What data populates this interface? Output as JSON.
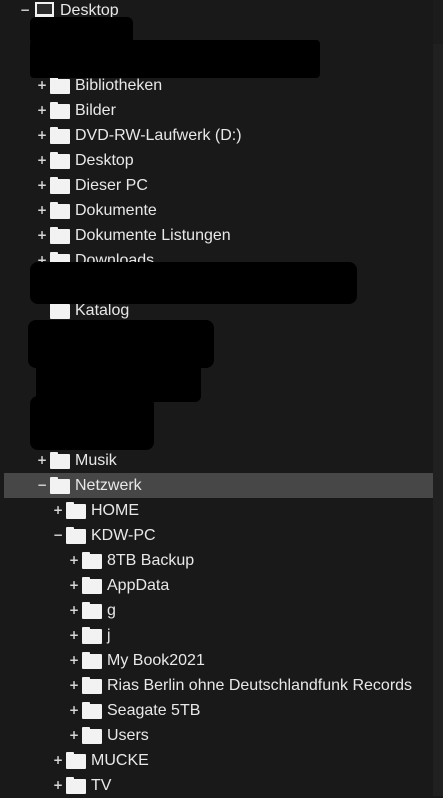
{
  "tree": {
    "root": {
      "label": "Desktop",
      "expander": "−",
      "icon": "monitor-icon"
    },
    "level1": [
      {
        "label": "Bibliotheken",
        "expander": "+"
      },
      {
        "label": "Bilder",
        "expander": "+"
      },
      {
        "label": "DVD-RW-Laufwerk (D:)",
        "expander": "+"
      },
      {
        "label": "Desktop",
        "expander": "+"
      },
      {
        "label": "Dieser PC",
        "expander": "+"
      },
      {
        "label": "Dokumente",
        "expander": "+"
      },
      {
        "label": "Dokumente Listungen",
        "expander": "+"
      },
      {
        "label": "Downloads",
        "expander": "+"
      },
      {
        "label": "Katalog",
        "expander": ""
      },
      {
        "label": "Musik",
        "expander": "+"
      },
      {
        "label": "Netzwerk",
        "expander": "−"
      }
    ],
    "network": [
      {
        "label": "HOME",
        "expander": "+"
      },
      {
        "label": "KDW-PC",
        "expander": "−"
      },
      {
        "label": "MUCKE",
        "expander": "+"
      },
      {
        "label": "TV",
        "expander": "+"
      }
    ],
    "kdw_pc": [
      {
        "label": "8TB Backup",
        "expander": "+"
      },
      {
        "label": "AppData",
        "expander": "+"
      },
      {
        "label": "g",
        "expander": "+"
      },
      {
        "label": "j",
        "expander": "+"
      },
      {
        "label": "My Book2021",
        "expander": "+"
      },
      {
        "label": "Rias Berlin ohne Deutschlandfunk Records",
        "expander": "+"
      },
      {
        "label": "Seagate 5TB",
        "expander": "+"
      },
      {
        "label": "Users",
        "expander": "+"
      }
    ]
  },
  "colors": {
    "background": "#191919",
    "selected_row": "#474747",
    "text": "#e8e8e8",
    "folder": "#f2f2f2"
  }
}
